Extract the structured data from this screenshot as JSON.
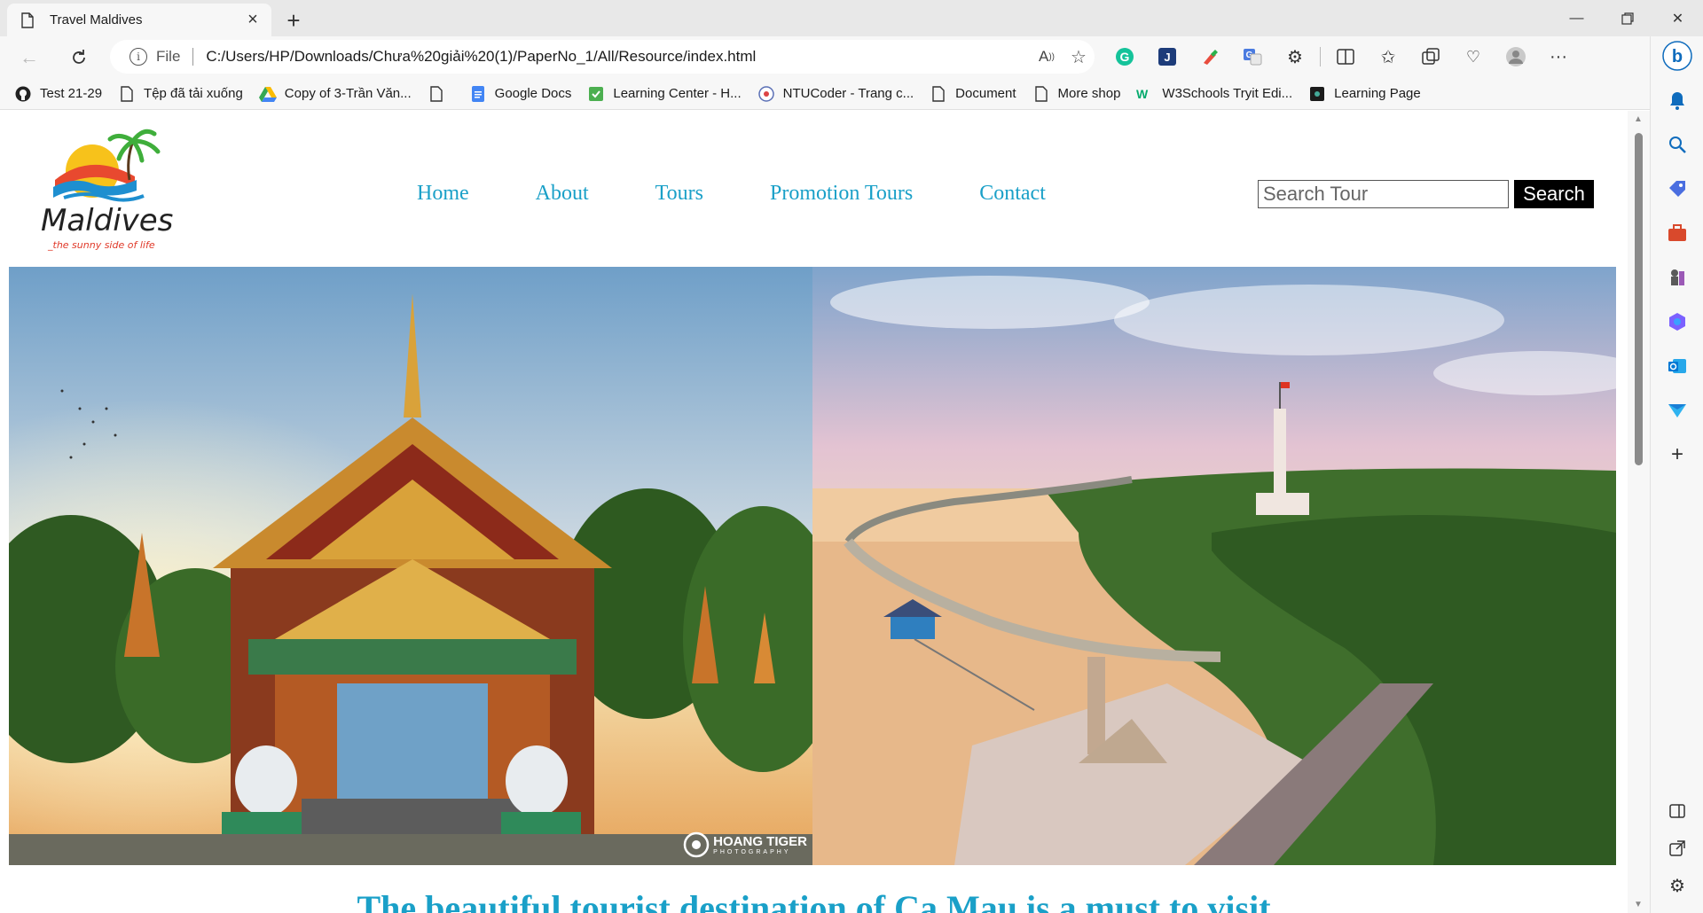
{
  "browser": {
    "tab_title": "Travel Maldives",
    "file_label": "File",
    "url": "C:/Users/HP/Downloads/Chưa%20giải%20(1)/PaperNo_1/All/Resource/index.html",
    "bookmarks": [
      {
        "label": "Test 21-29",
        "icon": "github-icon"
      },
      {
        "label": "Tệp đã tải xuống",
        "icon": "page-icon"
      },
      {
        "label": "Copy of 3-Trần Văn...",
        "icon": "google-drive-icon"
      },
      {
        "label": "",
        "icon": "page-icon"
      },
      {
        "label": "Google Docs",
        "icon": "google-docs-icon"
      },
      {
        "label": "Learning Center - H...",
        "icon": "learning-center-icon"
      },
      {
        "label": "NTUCoder - Trang c...",
        "icon": "ntucoder-icon"
      },
      {
        "label": "Document",
        "icon": "page-icon"
      },
      {
        "label": "More shop",
        "icon": "page-icon"
      },
      {
        "label": "W3Schools Tryit Edi...",
        "icon": "w3schools-icon"
      },
      {
        "label": "Learning Page",
        "icon": "learning-page-icon"
      }
    ]
  },
  "site": {
    "logo": {
      "text": "Maldives",
      "tagline": "_the sunny side of life"
    },
    "menu": [
      {
        "label": "Home"
      },
      {
        "label": "About"
      },
      {
        "label": "Tours"
      },
      {
        "label": "Promotion Tours"
      },
      {
        "label": "Contact"
      }
    ],
    "search": {
      "placeholder": "Search Tour",
      "button": "Search"
    },
    "watermark": {
      "title": "HOANG TIGER",
      "subtitle": "PHOTOGRAPHY"
    },
    "headline": "The beautiful tourist destination of Ca Mau is a must to visit"
  },
  "colors": {
    "accent": "#1aa0c8",
    "search_button": "#000000",
    "edge_blue": "#0f6cbd"
  }
}
